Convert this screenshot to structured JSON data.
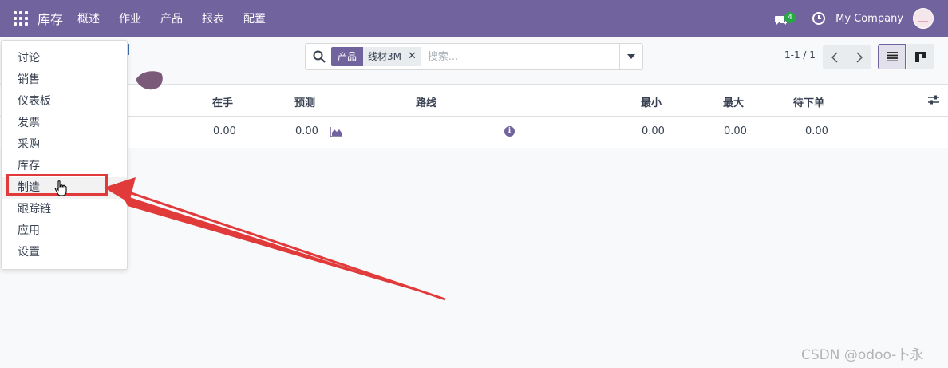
{
  "navbar": {
    "brand": "库存",
    "menu": [
      "概述",
      "作业",
      "产品",
      "报表",
      "配置"
    ],
    "chat_badge": "4",
    "company": "My Company",
    "icons": [
      "apps-grid-icon",
      "chat-icon",
      "clock-icon"
    ]
  },
  "search": {
    "facet_label": "产品",
    "facet_value": "线材3M",
    "placeholder": "搜索..."
  },
  "pager": {
    "text": "1-1 / 1"
  },
  "table": {
    "headers": {
      "on_hand": "在手",
      "forecast": "预测",
      "route": "路线",
      "min": "最小",
      "max": "最大",
      "to_order": "待下单"
    },
    "rows": [
      {
        "on_hand": "0.00",
        "forecast": "0.00",
        "min": "0.00",
        "max": "0.00",
        "to_order": "0.00"
      }
    ]
  },
  "app_menu": {
    "items": [
      "讨论",
      "销售",
      "仪表板",
      "发票",
      "采购",
      "库存",
      "制造",
      "跟踪链",
      "应用",
      "设置"
    ],
    "highlighted": "制造"
  },
  "annotation": {
    "color": "#e03a3a"
  },
  "colors": {
    "brand": "#71639e"
  },
  "watermark": "CSDN @odoo-卜永"
}
